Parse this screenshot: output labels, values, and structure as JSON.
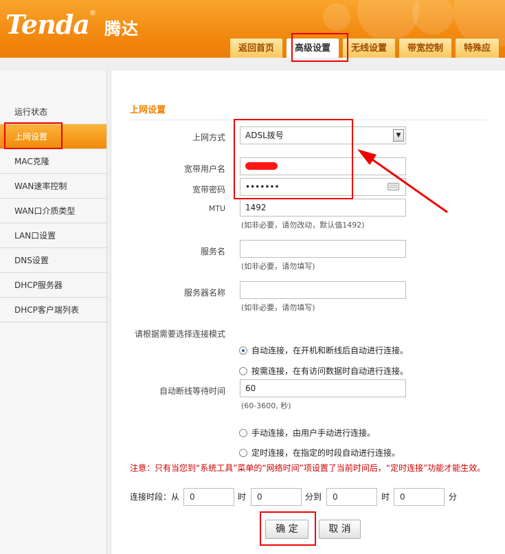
{
  "header": {
    "logo_text": "Tenda",
    "logo_registered": "®",
    "logo_cn": "腾达",
    "tabs": [
      {
        "label": "返回首页"
      },
      {
        "label": "高级设置"
      },
      {
        "label": "无线设置"
      },
      {
        "label": "带宽控制"
      },
      {
        "label": "特殊应"
      }
    ],
    "active_tab": "高级设置"
  },
  "sidebar": {
    "items": [
      {
        "label": "运行状态"
      },
      {
        "label": "上网设置"
      },
      {
        "label": "MAC克隆"
      },
      {
        "label": "WAN速率控制"
      },
      {
        "label": "WAN口介质类型"
      },
      {
        "label": "LAN口设置"
      },
      {
        "label": "DNS设置"
      },
      {
        "label": "DHCP服务器"
      },
      {
        "label": "DHCP客户端列表"
      }
    ],
    "active_item": "上网设置"
  },
  "form": {
    "section_title": "上网设置",
    "connection_type_label": "上网方式",
    "connection_type_value": "ADSL拨号",
    "username_label": "宽带用户名",
    "password_label": "宽带密码",
    "password_value": "•••••••",
    "mtu_label": "MTU",
    "mtu_value": "1492",
    "mtu_hint": "(如非必要，请勿改动，默认值1492)",
    "service_name_label": "服务名",
    "service_name_hint": "(如非必要，请勿填写)",
    "server_name_label": "服务器名称",
    "server_name_hint": "(如非必要，请勿填写)",
    "mode_prompt": "请根据需要选择连接模式",
    "mode_auto": "自动连接，在开机和断线后自动进行连接。",
    "mode_demand": "按需连接，在有访问数据时自动进行连接。",
    "idle_label": "自动断线等待时间",
    "idle_value": "60",
    "idle_hint": "(60-3600, 秒)",
    "mode_manual": "手动连接，由用户手动进行连接。",
    "mode_timed": "定时连接，在指定的时段自动进行连接。",
    "selected_mode": "auto",
    "note": "注意：只有当您到“系统工具”菜单的“网络时间”项设置了当前时间后，“定时连接”功能才能生效。",
    "period_label": "连接时段：从",
    "start_hour": "0",
    "hour_unit_1": "时",
    "start_minute": "0",
    "to_label": "分到",
    "end_hour": "0",
    "hour_unit_2": "时",
    "end_minute": "0",
    "minute_unit": "分",
    "ok_button": "确 定",
    "cancel_button": "取 消"
  },
  "colors": {
    "header_orange": "#f28b12",
    "accent_orange": "#f08300",
    "highlight_red": "#e00000",
    "note_red": "#cc0000"
  }
}
